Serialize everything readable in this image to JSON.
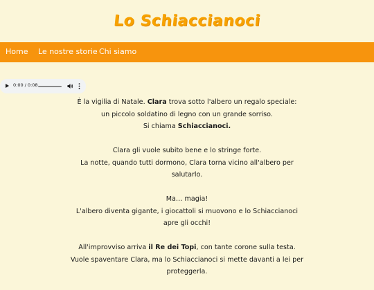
{
  "site": {
    "title": "Lo Schiaccianoci"
  },
  "nav": {
    "items": [
      {
        "label": "Home"
      },
      {
        "label": "Le nostre storie"
      },
      {
        "label": "Chi siamo"
      }
    ]
  },
  "audio": {
    "time": "0:00 / 0:08",
    "progress": 0,
    "icons": {
      "play": "play-icon",
      "volume": "volume-icon",
      "more": "more-vertical-icon"
    }
  },
  "story": {
    "p1": {
      "a": "È la vigilia di Natale. ",
      "b": "Clara",
      "c": " trova sotto l'albero un regalo speciale:",
      "d": "un piccolo soldatino di legno con un grande sorriso.",
      "e": "Si chiama ",
      "f": "Schiaccianoci."
    },
    "p2": {
      "a": "Clara gli vuole subito bene e lo stringe forte.",
      "b": "La notte, quando tutti dormono, Clara torna vicino all'albero per salutarlo."
    },
    "p3": {
      "a": "Ma… magia!",
      "b": "L'albero diventa gigante, i giocattoli si muovono e lo Schiaccianoci apre gli occhi!"
    },
    "p4": {
      "a": "All'improvviso arriva ",
      "b": "il Re dei Topi",
      "c": ", con tante corone sulla testa.",
      "d": "Vuole spaventare Clara, ma lo Schiaccianoci si mette davanti a lei per proteggerla."
    }
  }
}
